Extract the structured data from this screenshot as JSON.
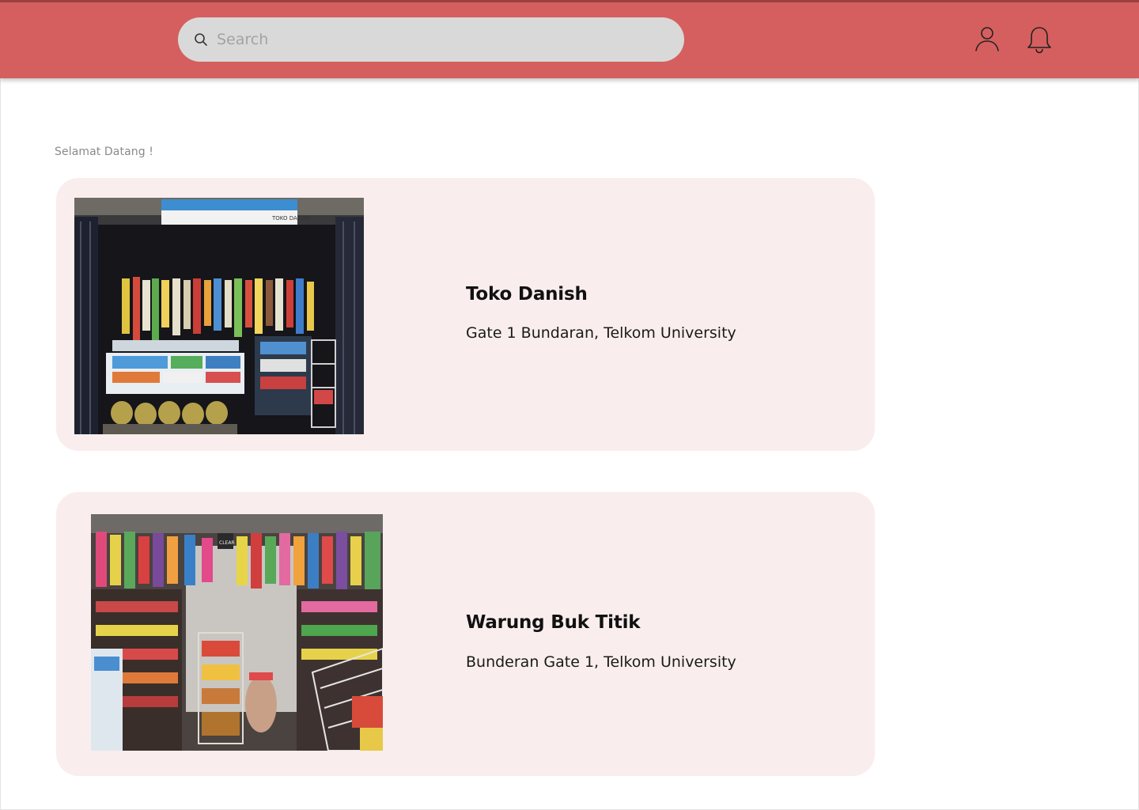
{
  "search": {
    "placeholder": "Search",
    "icon": "search-icon"
  },
  "header": {
    "background_color": "#d55f5f",
    "user_icon": "user-icon",
    "notification_icon": "bell-icon"
  },
  "greeting": "Selamat Datang !",
  "stores": [
    {
      "name": "Toko Danish",
      "address": "Gate 1 Bundaran, Telkom University",
      "photo_sign_text": "TOKO DANISH"
    },
    {
      "name": "Warung Buk Titik",
      "address": "Bunderan Gate 1, Telkom University",
      "photo_sign_text": "CLEAR"
    }
  ],
  "colors": {
    "card_background": "#f9eeed",
    "greeting_text": "#8a8a8a"
  }
}
